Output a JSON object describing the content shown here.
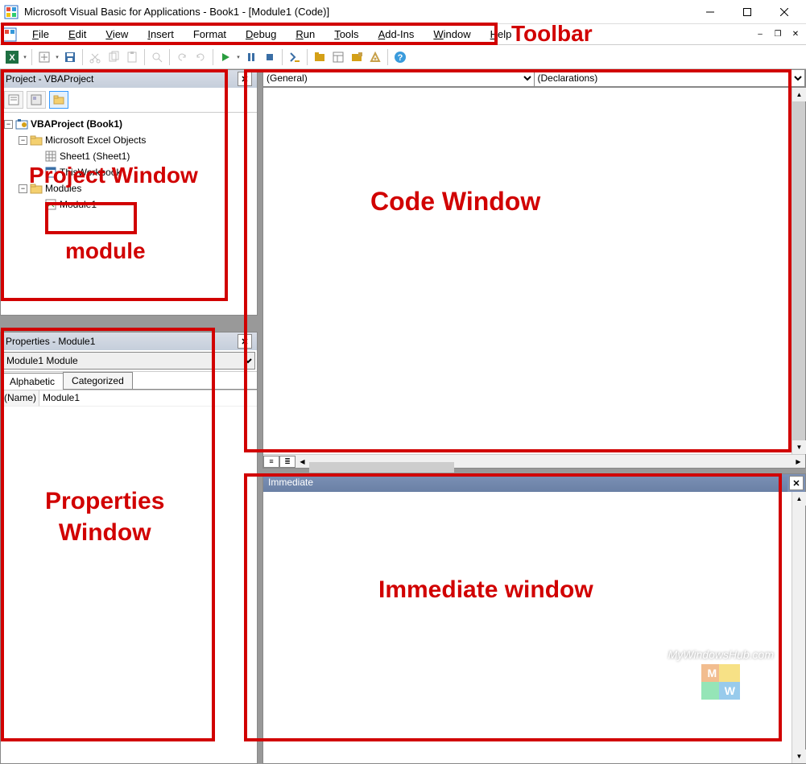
{
  "title": "Microsoft Visual Basic for Applications - Book1 - [Module1 (Code)]",
  "menu": [
    "File",
    "Edit",
    "View",
    "Insert",
    "Format",
    "Debug",
    "Run",
    "Tools",
    "Add-Ins",
    "Window",
    "Help"
  ],
  "project": {
    "title": "Project - VBAProject",
    "root": "VBAProject (Book1)",
    "excelObjects": "Microsoft Excel Objects",
    "sheet": "Sheet1 (Sheet1)",
    "workbook": "ThisWorkbook",
    "modules": "Modules",
    "module1": "Module1"
  },
  "properties": {
    "title": "Properties - Module1",
    "objLabel": "Module1 Module",
    "tabs": [
      "Alphabetic",
      "Categorized"
    ],
    "row": {
      "name": "(Name)",
      "value": "Module1"
    }
  },
  "code": {
    "ddLeft": "(General)",
    "ddRight": "(Declarations)"
  },
  "immediate": {
    "title": "Immediate"
  },
  "annotations": {
    "toolbar": "Toolbar",
    "projectWin": "Project Window",
    "module": "module",
    "codeWin": "Code Window",
    "propsWin": "Properties Window",
    "immWin": "Immediate window"
  },
  "watermark": "MyWindowsHub.com"
}
